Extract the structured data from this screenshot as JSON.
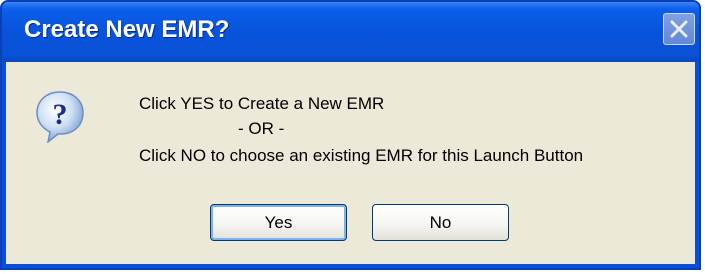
{
  "dialog": {
    "title": "Create New EMR?",
    "message_line1": "Click YES to Create a New EMR",
    "message_line2": "- OR -",
    "message_line3": "Click NO to choose an existing EMR for this Launch Button",
    "icon": "question-icon",
    "close_icon": "close-icon"
  },
  "buttons": {
    "yes_label": "Yes",
    "no_label": "No"
  },
  "colors": {
    "titlebar": "#0753dc",
    "client_bg": "#ece9d8",
    "button_border": "#003c74"
  }
}
